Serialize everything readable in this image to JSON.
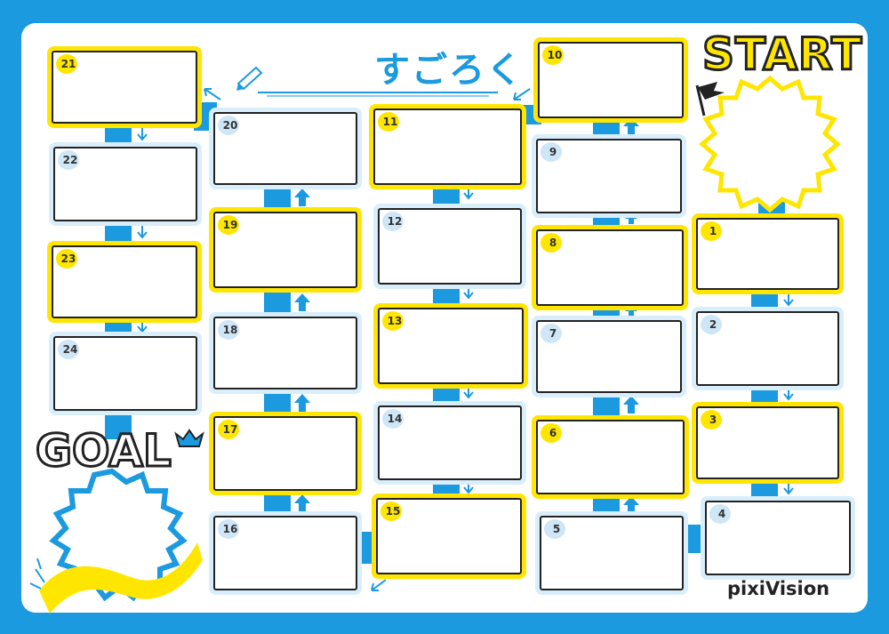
{
  "title": "すごろく",
  "start_label": "START",
  "goal_label_left": "GO",
  "goal_label_o": "A",
  "goal_label_right": "L",
  "logo": "pixiVision",
  "squares": [
    "1",
    "2",
    "3",
    "4",
    "5",
    "6",
    "7",
    "8",
    "9",
    "10",
    "11",
    "12",
    "13",
    "14",
    "15",
    "16",
    "17",
    "18",
    "19",
    "20",
    "21",
    "22",
    "23",
    "24"
  ],
  "colors": {
    "frame_blue": "#1b9ae0",
    "highlight_yellow": "#ffe600",
    "light_blue": "#cfe6f7"
  },
  "icons": {
    "pencil": "pencil-icon",
    "flag": "flag-icon",
    "crown": "crown-icon",
    "ribbon": "ribbon-icon"
  }
}
